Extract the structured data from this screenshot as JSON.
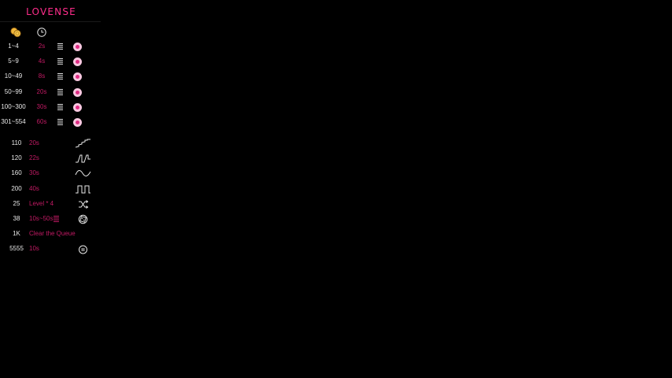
{
  "brand": {
    "logo_text": "LOVENSE",
    "accent": "#ff2d8b",
    "duration_color": "#c21a64"
  },
  "header_icons": [
    "coins-icon",
    "clock-icon"
  ],
  "levels": [
    {
      "range": "1~4",
      "duration": "2s"
    },
    {
      "range": "5~9",
      "duration": "4s"
    },
    {
      "range": "10~49",
      "duration": "8s"
    },
    {
      "range": "50~99",
      "duration": "20s"
    },
    {
      "range": "100~300",
      "duration": "30s"
    },
    {
      "range": "301~554",
      "duration": "60s"
    }
  ],
  "specials": [
    {
      "amount": "110",
      "text": "20s",
      "icon": "wave-stairs-icon"
    },
    {
      "amount": "120",
      "text": "22s",
      "icon": "wave-pulse-icon"
    },
    {
      "amount": "160",
      "text": "30s",
      "icon": "wave-sine-icon"
    },
    {
      "amount": "200",
      "text": "40s",
      "icon": "wave-square-icon"
    },
    {
      "amount": "25",
      "text": "Level * 4",
      "icon": "shuffle-icon"
    },
    {
      "amount": "38",
      "text": "10s~50s",
      "icon": "dice-icon"
    },
    {
      "amount": "1K",
      "text": "Clear the Queue",
      "icon": ""
    },
    {
      "amount": "5555",
      "text": "10s",
      "icon": "pause-icon"
    }
  ]
}
